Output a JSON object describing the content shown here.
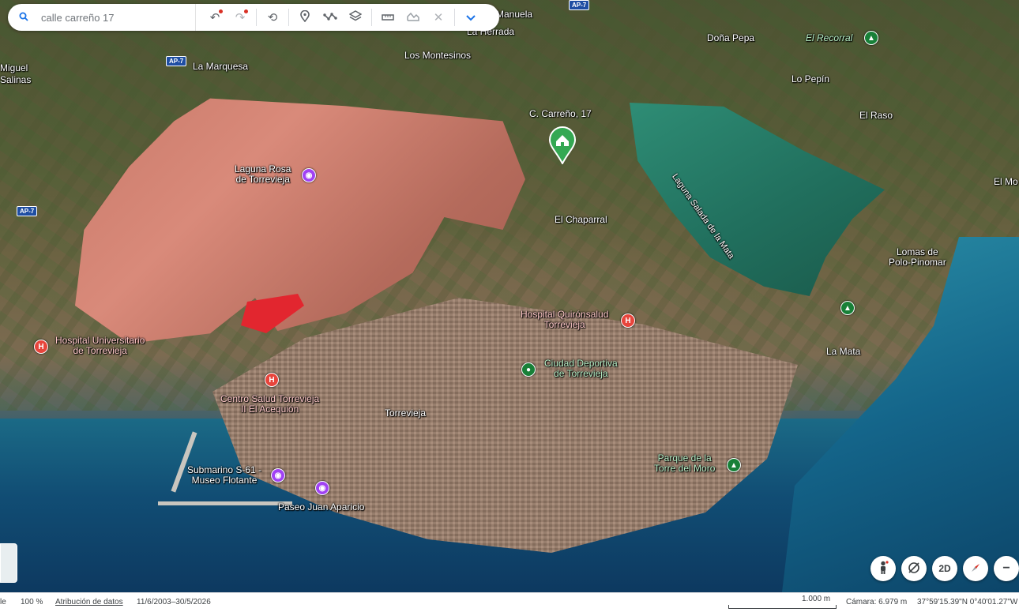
{
  "search": {
    "value": "calle carreño 17"
  },
  "toolbar": {
    "icons": [
      "search-icon",
      "undo-icon",
      "redo-icon",
      "history-icon",
      "pin-icon",
      "path-icon",
      "layers-icon",
      "ruler-icon",
      "terrain-icon",
      "tools-icon",
      "chevron-down-icon"
    ]
  },
  "map": {
    "roads": {
      "ap7_a": "AP-7",
      "ap7_b": "AP-7",
      "ap7_c": "AP-7"
    },
    "places": {
      "manuela": "Manuela",
      "la_herrada": "La Herrada",
      "dona_pepa": "Doña Pepa",
      "el_recorral": "El Recorral",
      "la_marquesa": "La Marquesa",
      "los_montesinos": "Los Montesinos",
      "miguel": "Miguel",
      "salinas": "Salinas",
      "lo_pepin": "Lo Pepín",
      "el_raso": "El Raso",
      "c_carreno": "C. Carreño, 17",
      "laguna_rosa_1": "Laguna Rosa",
      "laguna_rosa_2": "de Torrevieja",
      "laguna_salada": "Laguna Salada de la Mata",
      "el_mo": "El Mo",
      "el_chaparral": "El Chaparral",
      "lomas_1": "Lomas de",
      "lomas_2": "Polo-Pinomar",
      "hospital_quiron_1": "Hospital Quirónsalud",
      "hospital_quiron_2": "Torrevieja",
      "hospital_univ_1": "Hospital Universitario",
      "hospital_univ_2": "de Torrevieja",
      "la_mata": "La Mata",
      "ciudad_deportiva_1": "Ciudad Deportiva",
      "ciudad_deportiva_2": "de Torrevieja",
      "centro_salud_1": "Centro Salud Torrevieja",
      "centro_salud_2": "II El Acequión",
      "torrevieja": "Torrevieja",
      "parque_1": "Parque de la",
      "parque_2": "Torre del Moro",
      "submarino_1": "Submarino S-61 -",
      "submarino_2": "Museo Flotante",
      "paseo": "Paseo Juan Aparicio"
    }
  },
  "controls": {
    "mode_2d": "2D",
    "zoom_out": "−"
  },
  "status": {
    "left_partial": "le",
    "zoom": "100 %",
    "attribution": "Atribución de datos",
    "dates": "11/6/2003–30/5/2026",
    "scale": "1.000 m",
    "camera": "Cámara: 6.979 m",
    "coords": "37°59'15.39\"N 0°40'01.27\"W"
  }
}
